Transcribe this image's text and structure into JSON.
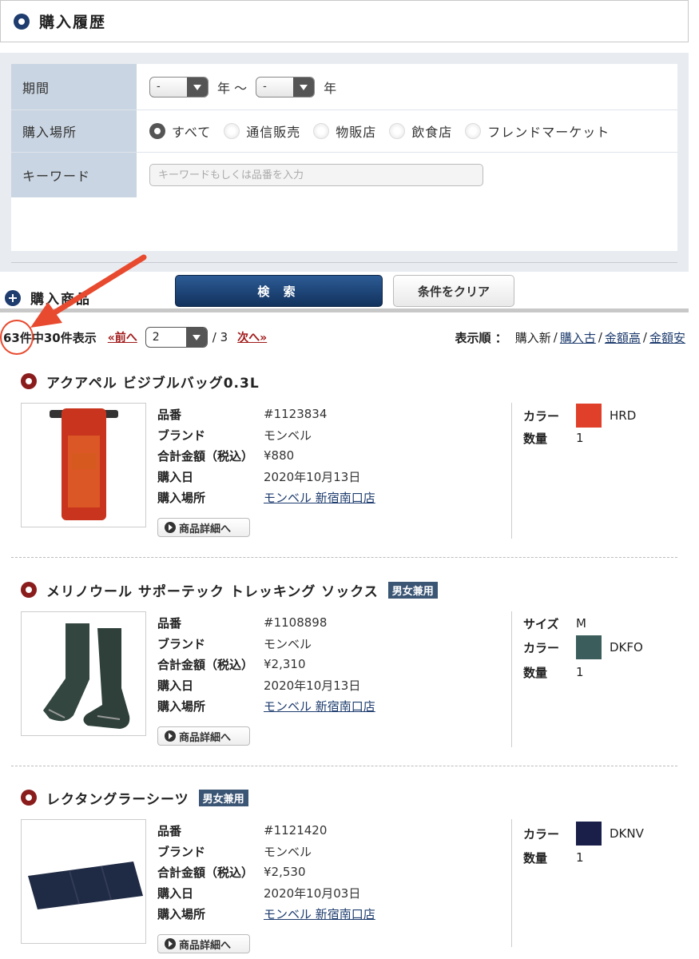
{
  "header": {
    "title": "購入履歴"
  },
  "search": {
    "period_label": "期間",
    "year_from": "-",
    "year_unit_1": "年 〜",
    "year_to": "-",
    "year_unit_2": "年",
    "place_label": "購入場所",
    "places": [
      "すべて",
      "通信販売",
      "物販店",
      "飲食店",
      "フレンドマーケット"
    ],
    "place_selected": "すべて",
    "keyword_label": "キーワード",
    "keyword_placeholder": "キーワードもしくは品番を入力",
    "keyword_value": "",
    "search_button": "検 索",
    "clear_button": "条件をクリア"
  },
  "results": {
    "section_title": "購入商品",
    "count_text": "63件中30件表示",
    "prev": "«前へ",
    "page": "2",
    "total_pages": "/ 3",
    "next": "次へ»",
    "sort_label": "表示順 ：",
    "sort_current": "購入新",
    "sort_options": [
      "購入古",
      "金額高",
      "金額安"
    ]
  },
  "labels": {
    "code": "品番",
    "brand": "ブランド",
    "total": "合計金額（税込）",
    "date": "購入日",
    "place": "購入場所",
    "detail": "商品詳細へ",
    "size": "サイズ",
    "color": "カラー",
    "qty": "数量"
  },
  "products": [
    {
      "name": "アクアペル ビジブルバッグ0.3L",
      "badge": "",
      "code": "#1123834",
      "brand": "モンベル",
      "total": "¥880",
      "date": "2020年10月13日",
      "place": "モンベル 新宿南口店",
      "color_name": "HRD",
      "color_hex": "#e0402a",
      "qty": "1"
    },
    {
      "name": "メリノウール サポーテック トレッキング ソックス",
      "badge": "男女兼用",
      "code": "#1108898",
      "brand": "モンベル",
      "total": "¥2,310",
      "date": "2020年10月13日",
      "place": "モンベル 新宿南口店",
      "size": "M",
      "color_name": "DKFO",
      "color_hex": "#3b5e5c",
      "qty": "1"
    },
    {
      "name": "レクタングラーシーツ",
      "badge": "男女兼用",
      "code": "#1121420",
      "brand": "モンベル",
      "total": "¥2,530",
      "date": "2020年10月03日",
      "place": "モンベル 新宿南口店",
      "color_name": "DKNV",
      "color_hex": "#1a1f4a",
      "qty": "1"
    }
  ],
  "colors": {
    "accent": "#1e3c6e",
    "annotation": "#e84a2f",
    "link_red": "#a01818"
  }
}
